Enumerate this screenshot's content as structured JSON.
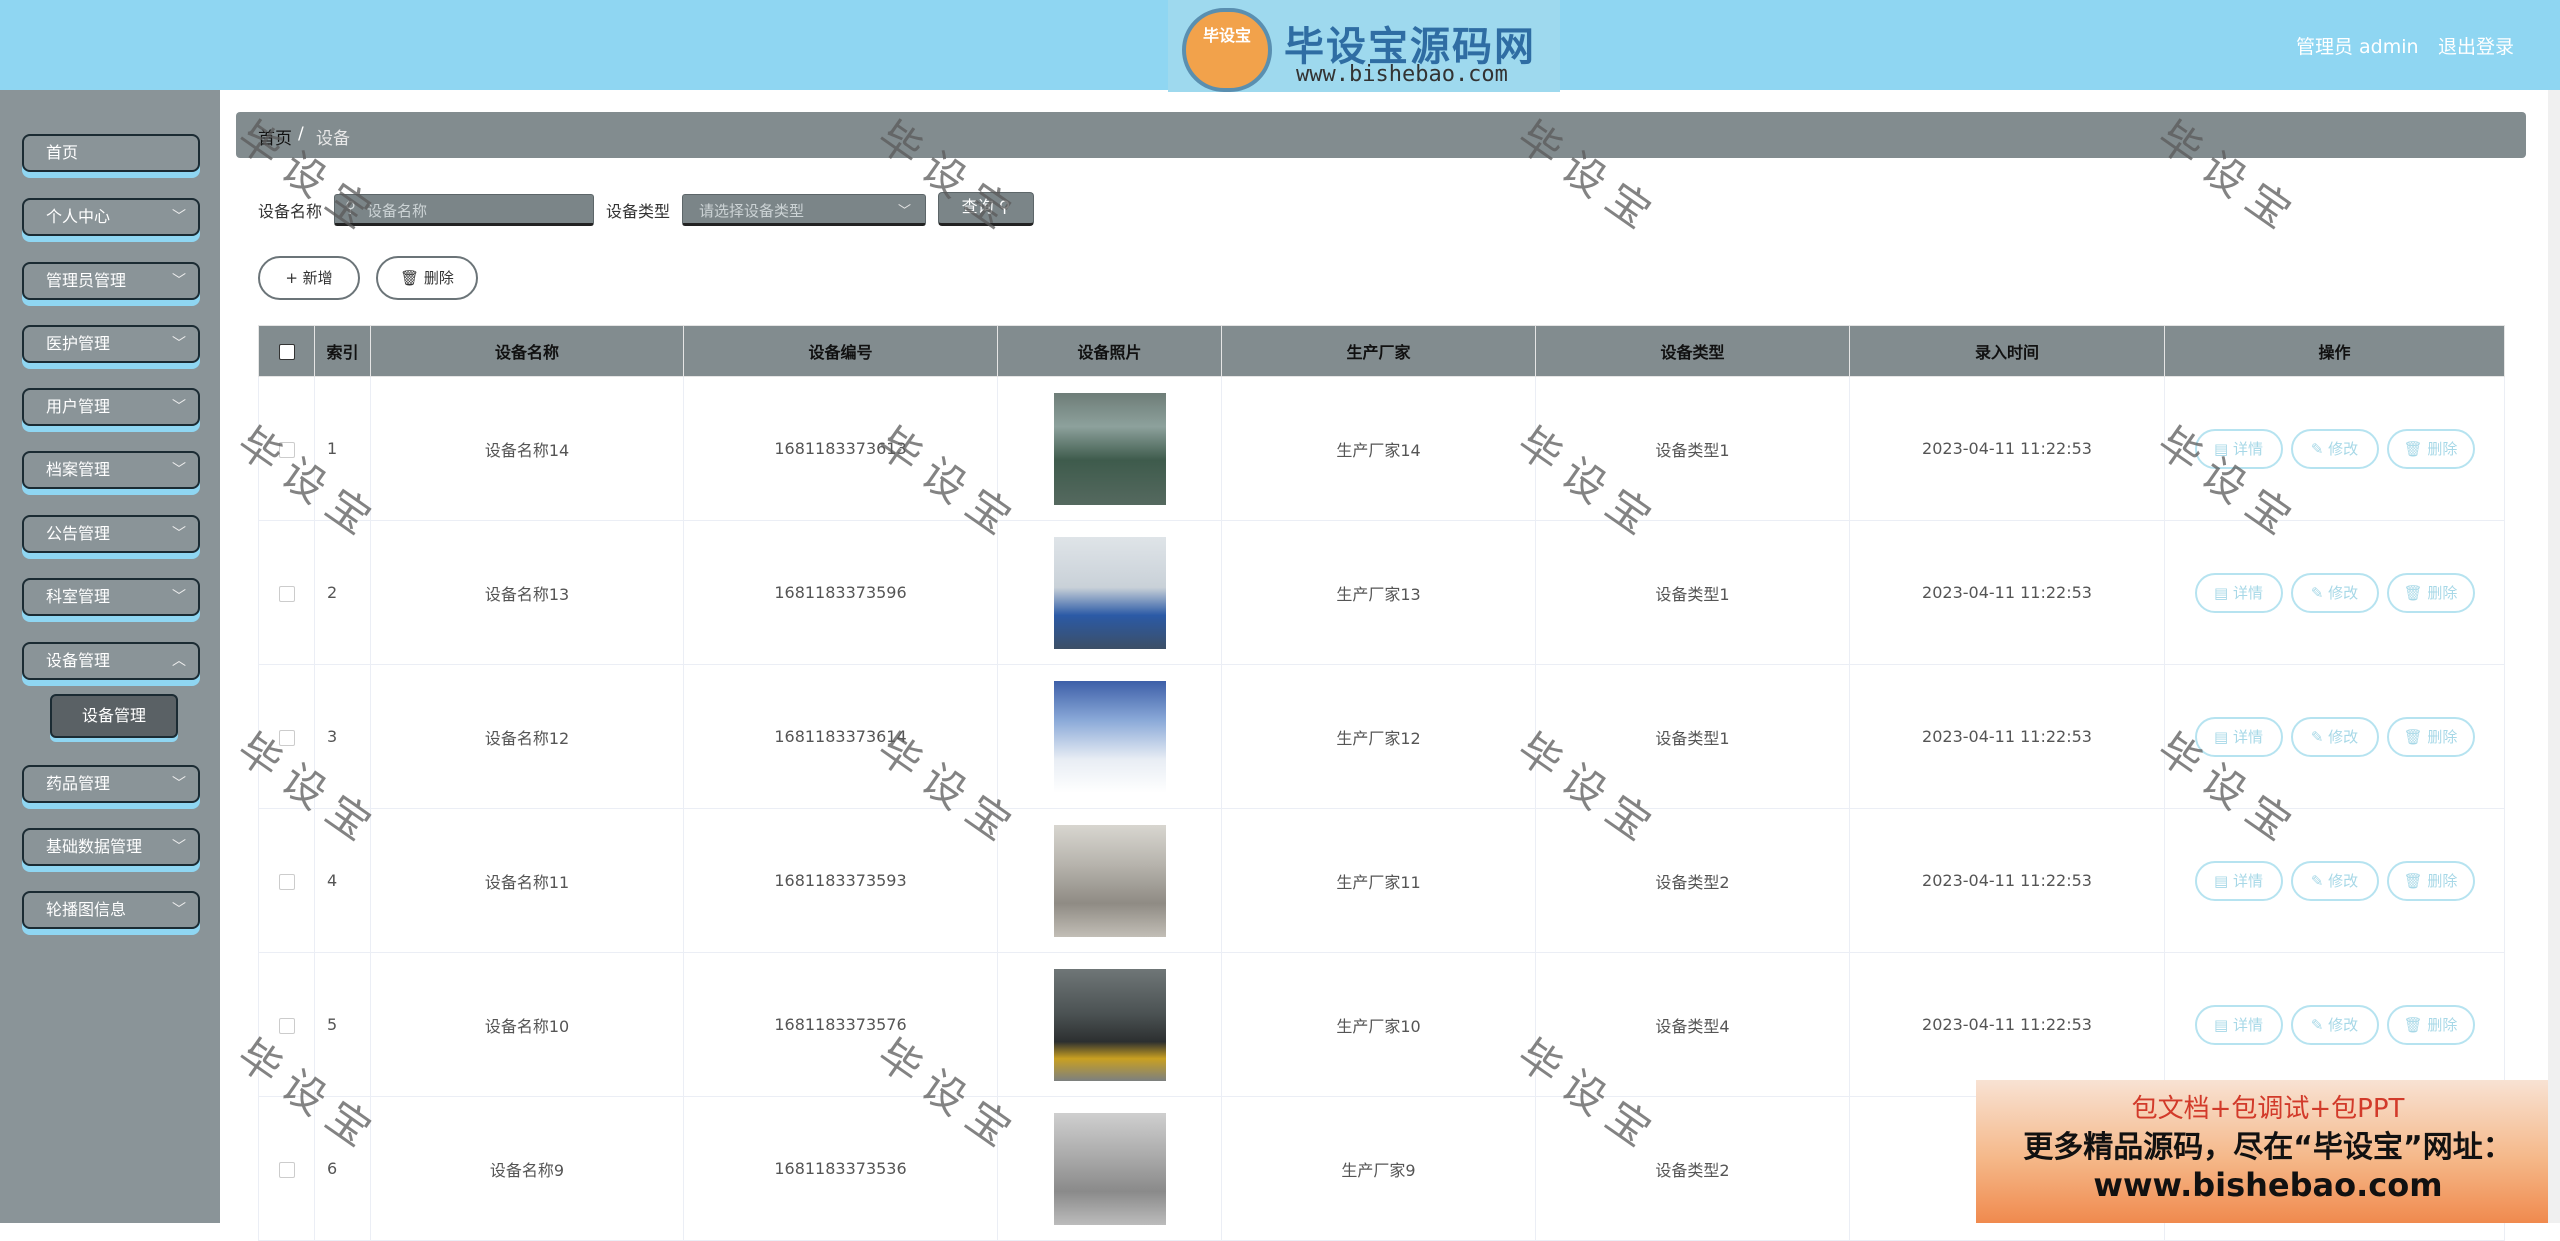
{
  "header": {
    "logo_badge": "毕设宝",
    "logo_title": "毕设宝源码网",
    "logo_url": "www.bishebao.com",
    "user_label": "管理员 admin",
    "logout_label": "退出登录"
  },
  "sidebar": {
    "items": [
      {
        "label": "首页"
      },
      {
        "label": "个人中心"
      },
      {
        "label": "管理员管理"
      },
      {
        "label": "医护管理"
      },
      {
        "label": "用户管理"
      },
      {
        "label": "档案管理"
      },
      {
        "label": "公告管理"
      },
      {
        "label": "科室管理"
      },
      {
        "label": "设备管理"
      },
      {
        "label": "药品管理"
      },
      {
        "label": "基础数据管理"
      },
      {
        "label": "轮播图信息"
      }
    ],
    "submenu": {
      "label": "设备管理"
    }
  },
  "breadcrumb": {
    "home": "首页",
    "separator": "/",
    "current": "设备"
  },
  "search": {
    "name_label": "设备名称",
    "name_placeholder": "设备名称",
    "type_label": "设备类型",
    "type_placeholder": "请选择设备类型",
    "query_label": "查询"
  },
  "actions": {
    "add_label": "+ 新增",
    "delete_label": "删除"
  },
  "table": {
    "headers": [
      "索引",
      "设备名称",
      "设备编号",
      "设备照片",
      "生产厂家",
      "设备类型",
      "录入时间",
      "操作"
    ],
    "op_labels": {
      "detail": "详情",
      "edit": "修改",
      "delete": "删除"
    },
    "rows": [
      {
        "index": "1",
        "name": "设备名称14",
        "code": "1681183373613",
        "maker": "生产厂家14",
        "type": "设备类型1",
        "time": "2023-04-11 11:22:53"
      },
      {
        "index": "2",
        "name": "设备名称13",
        "code": "1681183373596",
        "maker": "生产厂家13",
        "type": "设备类型1",
        "time": "2023-04-11 11:22:53"
      },
      {
        "index": "3",
        "name": "设备名称12",
        "code": "1681183373614",
        "maker": "生产厂家12",
        "type": "设备类型1",
        "time": "2023-04-11 11:22:53"
      },
      {
        "index": "4",
        "name": "设备名称11",
        "code": "1681183373593",
        "maker": "生产厂家11",
        "type": "设备类型2",
        "time": "2023-04-11 11:22:53"
      },
      {
        "index": "5",
        "name": "设备名称10",
        "code": "1681183373576",
        "maker": "生产厂家10",
        "type": "设备类型4",
        "time": "2023-04-11 11:22:53"
      },
      {
        "index": "6",
        "name": "设备名称9",
        "code": "1681183373536",
        "maker": "生产厂家9",
        "type": "设备类型2",
        "time": "2023-"
      }
    ]
  },
  "watermark": {
    "text": "毕设宝"
  },
  "ad": {
    "line1": "包文档+包调试+包PPT",
    "line2": "更多精品源码，尽在“毕设宝”网址：",
    "line3": "www.bishebao.com"
  }
}
